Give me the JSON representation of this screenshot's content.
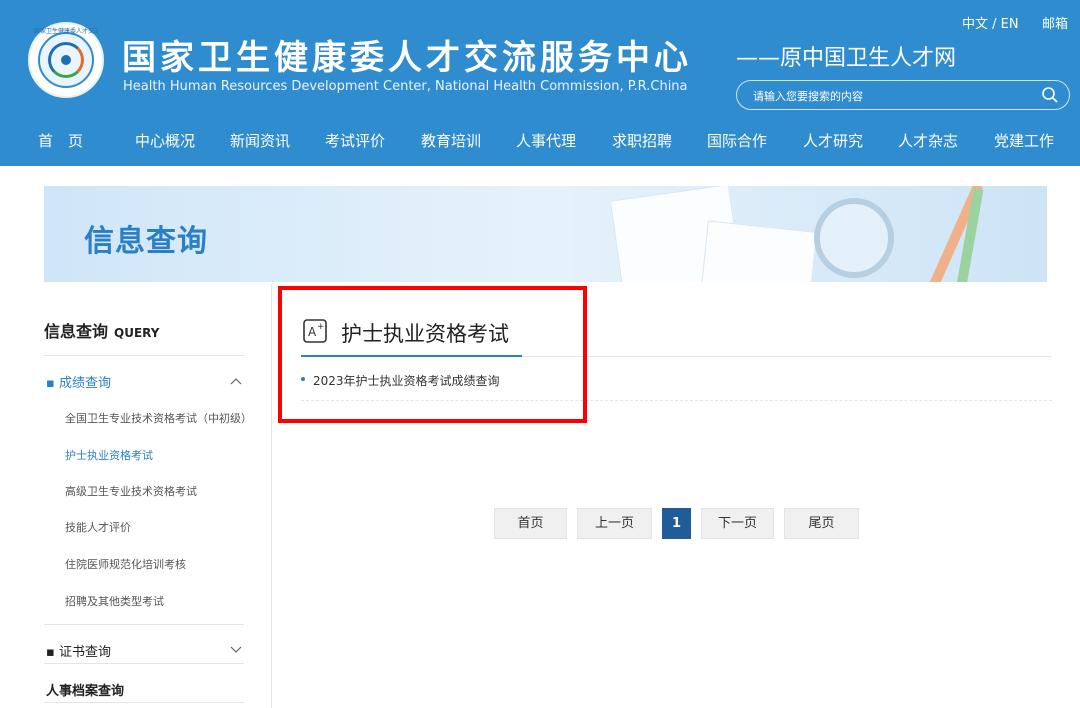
{
  "header": {
    "logo_text": "国家卫生健康委人才交流服务中心",
    "title": "国家卫生健康委人才交流服务中心",
    "subtitle": "——原中国卫生人才网",
    "english": "Health Human Resources Development Center, National Health Commission, P.R.China",
    "lang": "中文 / EN",
    "mail": "邮箱",
    "search_placeholder": "请输入您要搜索的内容"
  },
  "nav": [
    "首　页",
    "中心概况",
    "新闻资讯",
    "考试评价",
    "教育培训",
    "人事代理",
    "求职招聘",
    "国际合作",
    "人才研究",
    "人才杂志",
    "党建工作"
  ],
  "banner": {
    "title": "信息查询"
  },
  "sidebar": {
    "title": "信息查询",
    "title_en": "QUERY",
    "groups": [
      {
        "label": "成绩查询",
        "expanded": true
      },
      {
        "label": "证书查询",
        "expanded": false
      },
      {
        "label": "人事档案查询"
      }
    ],
    "sub_items": [
      "全国卫生专业技术资格考试（中初级）",
      "护士执业资格考试",
      "高级卫生专业技术资格考试",
      "技能人才评价",
      "住院医师规范化培训考核",
      "招聘及其他类型考试"
    ]
  },
  "main": {
    "title": "护士执业资格考试",
    "items": [
      "2023年护士执业资格考试成绩查询"
    ]
  },
  "pagination": {
    "first": "首页",
    "prev": "上一页",
    "current": "1",
    "next": "下一页",
    "last": "尾页"
  },
  "colors": {
    "header_bg": "#2f8ccf",
    "accent": "#2b7fc4",
    "page_current": "#1f5c99",
    "highlight": "#ff0000"
  }
}
